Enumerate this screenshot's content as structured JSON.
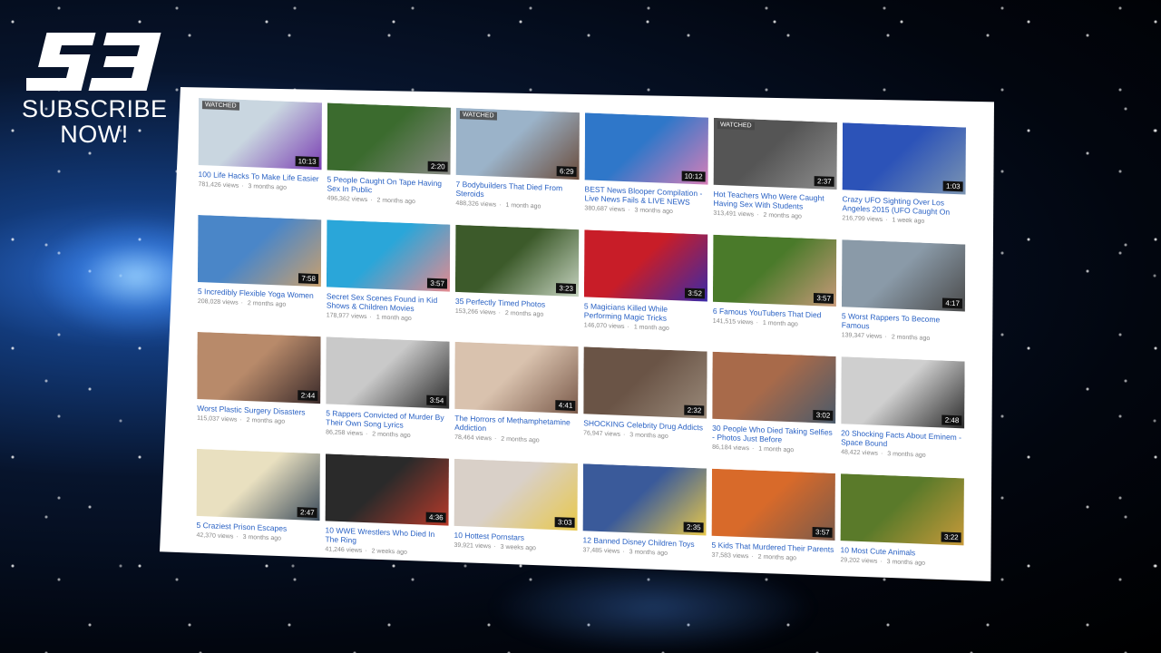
{
  "brand": {
    "logo_text": "S3",
    "cta_line1": "SUBSCRIBE",
    "cta_line2": "NOW!"
  },
  "videos": [
    {
      "title": "100 Life Hacks To Make Life Easier",
      "views": "781,426 views",
      "age": "3 months ago",
      "duration": "10:13",
      "watched": "WATCHED",
      "c1": "#c9d6e0",
      "c2": "#7a3fb3"
    },
    {
      "title": "5 People Caught On Tape Having Sex In Public",
      "views": "496,362 views",
      "age": "2 months ago",
      "duration": "2:20",
      "watched": "",
      "c1": "#3b6b2e",
      "c2": "#8a8a86"
    },
    {
      "title": "7 Bodybuilders That Died From Steroids",
      "views": "488,326 views",
      "age": "1 month ago",
      "duration": "6:29",
      "watched": "WATCHED",
      "c1": "#9bb3c9",
      "c2": "#6a4b3a"
    },
    {
      "title": "BEST News Blooper Compilation - Live News Fails & LIVE NEWS",
      "views": "380,687 views",
      "age": "3 months ago",
      "duration": "10:12",
      "watched": "",
      "c1": "#2f77c9",
      "c2": "#d77fb8"
    },
    {
      "title": "Hot Teachers Who Were Caught Having Sex With Students",
      "views": "313,491 views",
      "age": "2 months ago",
      "duration": "2:37",
      "watched": "WATCHED",
      "c1": "#555555",
      "c2": "#8f8f8f"
    },
    {
      "title": "Crazy UFO Sighting Over Los Angeles 2015 (UFO Caught On",
      "views": "216,799 views",
      "age": "1 week ago",
      "duration": "1:03",
      "watched": "",
      "c1": "#2c53b8",
      "c2": "#7c95b2"
    },
    {
      "title": "5 Incredibly Flexible Yoga Women",
      "views": "208,028 views",
      "age": "2 months ago",
      "duration": "7:58",
      "watched": "",
      "c1": "#4a86c8",
      "c2": "#c9a06e"
    },
    {
      "title": "Secret Sex Scenes Found in Kid Shows & Children Movies",
      "views": "178,977 views",
      "age": "1 month ago",
      "duration": "3:57",
      "watched": "",
      "c1": "#2aa6d9",
      "c2": "#e58a8f"
    },
    {
      "title": "35 Perfectly Timed Photos",
      "views": "153,266 views",
      "age": "2 months ago",
      "duration": "3:23",
      "watched": "",
      "c1": "#3c5a2a",
      "c2": "#c6d3c0"
    },
    {
      "title": "5 Magicians Killed While Performing Magic Tricks",
      "views": "146,070 views",
      "age": "1 month ago",
      "duration": "3:52",
      "watched": "",
      "c1": "#c81d28",
      "c2": "#3a2aa8"
    },
    {
      "title": "6 Famous YouTubers That Died",
      "views": "141,515 views",
      "age": "1 month ago",
      "duration": "3:57",
      "watched": "",
      "c1": "#4a7a2a",
      "c2": "#c89a7a"
    },
    {
      "title": "5 Worst Rappers To Become Famous",
      "views": "139,347 views",
      "age": "2 months ago",
      "duration": "4:17",
      "watched": "",
      "c1": "#8a9aa8",
      "c2": "#4a4a4a"
    },
    {
      "title": "Worst Plastic Surgery Disasters",
      "views": "115,037 views",
      "age": "2 months ago",
      "duration": "2:44",
      "watched": "",
      "c1": "#b88a6a",
      "c2": "#3a2a2a"
    },
    {
      "title": "5 Rappers Convicted of Murder By Their Own Song Lyrics",
      "views": "86,258 views",
      "age": "2 months ago",
      "duration": "3:54",
      "watched": "",
      "c1": "#c9c9c9",
      "c2": "#2a2a2a"
    },
    {
      "title": "The Horrors of Methamphetamine Addiction",
      "views": "78,464 views",
      "age": "2 months ago",
      "duration": "4:41",
      "watched": "",
      "c1": "#d9c2ae",
      "c2": "#7a5a4a"
    },
    {
      "title": "SHOCKING Celebrity Drug Addicts",
      "views": "76,947 views",
      "age": "3 months ago",
      "duration": "2:32",
      "watched": "",
      "c1": "#6a5446",
      "c2": "#9a8a7a"
    },
    {
      "title": "30 People Who Died Taking Selfies - Photos Just Before",
      "views": "86,184 views",
      "age": "1 month ago",
      "duration": "3:02",
      "watched": "",
      "c1": "#a86a4a",
      "c2": "#4a5a6a"
    },
    {
      "title": "20 Shocking Facts About Eminem - Space Bound",
      "views": "48,422 views",
      "age": "3 months ago",
      "duration": "2:48",
      "watched": "",
      "c1": "#cfcfcf",
      "c2": "#2a2a2a"
    },
    {
      "title": "5 Craziest Prison Escapes",
      "views": "42,370 views",
      "age": "3 months ago",
      "duration": "2:47",
      "watched": "",
      "c1": "#e9e0c0",
      "c2": "#3a4a5a"
    },
    {
      "title": "10 WWE Wrestlers Who Died In The Ring",
      "views": "41,246 views",
      "age": "2 weeks ago",
      "duration": "4:36",
      "watched": "",
      "c1": "#2a2a2a",
      "c2": "#b83a2a"
    },
    {
      "title": "10 Hottest Pornstars",
      "views": "39,921 views",
      "age": "3 weeks ago",
      "duration": "3:03",
      "watched": "",
      "c1": "#d9d0c8",
      "c2": "#e8c84a"
    },
    {
      "title": "12 Banned Disney Children Toys",
      "views": "37,485 views",
      "age": "3 months ago",
      "duration": "2:35",
      "watched": "",
      "c1": "#3a5a9a",
      "c2": "#e8c84a"
    },
    {
      "title": "5 Kids That Murdered Their Parents",
      "views": "37,583 views",
      "age": "2 months ago",
      "duration": "3:57",
      "watched": "",
      "c1": "#d86a2a",
      "c2": "#7a5a4a"
    },
    {
      "title": "10 Most Cute Animals",
      "views": "29,202 views",
      "age": "3 months ago",
      "duration": "3:22",
      "watched": "",
      "c1": "#5a7a2a",
      "c2": "#c89a3a"
    }
  ]
}
